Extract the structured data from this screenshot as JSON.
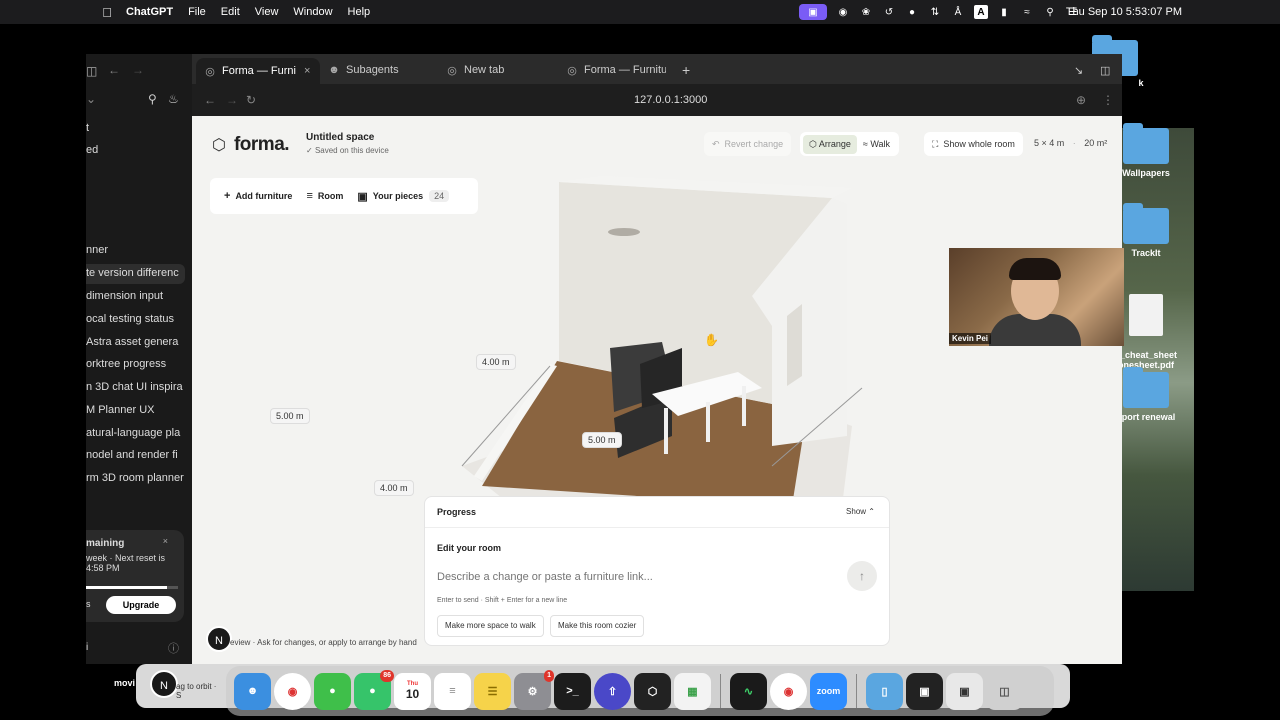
{
  "menubar": {
    "app_name": "ChatGPT",
    "menus": [
      "File",
      "Edit",
      "View",
      "Window",
      "Help"
    ],
    "status_icons": [
      "screen-record-icon",
      "zoom-icon",
      "openai-icon",
      "spiral-icon",
      "wechat-icon",
      "control-icon",
      "bluetooth-icon",
      "input-a-icon",
      "battery-icon",
      "wifi-icon",
      "search-icon",
      "control-center-icon"
    ],
    "input_source": "A",
    "clock": "Thu Sep 10  5:53:07 PM"
  },
  "desktop": {
    "items": [
      "k",
      "Wallpapers",
      "TrackIt",
      "3_cheat_sheet\nonesheet.pdf",
      "sport renewal"
    ]
  },
  "browser": {
    "tabs": [
      {
        "label": "Forma — Furni",
        "icon": "globe-icon",
        "active": true
      },
      {
        "label": "Subagents",
        "icon": "person-icon",
        "active": false
      },
      {
        "label": "New tab",
        "icon": "globe-icon",
        "active": false
      },
      {
        "label": "Forma — Furnitu",
        "icon": "globe-icon",
        "active": false
      }
    ],
    "url": "127.0.0.1:3000"
  },
  "sidebar": {
    "items": [
      "t",
      "ed",
      "nner",
      "te version differenc",
      " dimension input",
      "ocal testing status",
      " Astra asset genera",
      "orktree progress",
      "n 3D chat UI inspira",
      "M Planner UX",
      "atural-language pla",
      "nodel and render fi",
      "rm 3D room planner"
    ],
    "selected_index": 3,
    "usage": {
      "title": "maining",
      "line1": "week · Next reset is",
      "line2": "4:58 PM",
      "left_button": "s",
      "upgrade": "Upgrade",
      "used_fraction": 0.88
    },
    "footer_letter": "i"
  },
  "forma": {
    "brand": "forma.",
    "space_title": "Untitled space",
    "space_status": "Saved on this device",
    "revert": "Revert change",
    "arrange": "Arrange",
    "walk": "Walk",
    "show_room": "Show whole room",
    "room_dims": "5 × 4 m",
    "room_area": "20 m²",
    "toolbar": {
      "add": "Add furniture",
      "room": "Room",
      "pieces": "Your pieces",
      "pieces_count": "24"
    },
    "dimensions": {
      "left": "5.00 m",
      "right": "5.00 m",
      "bottom": "4.00 m",
      "table": "4.00 m"
    },
    "panel": {
      "header": "Progress",
      "toggle": "Show",
      "edit_title": "Edit your room",
      "placeholder": "Describe a change or paste a furniture link...",
      "hint": "Enter to send · Shift + Enter for a new line",
      "chips": [
        "Make more space to walk",
        "Make this room cozier"
      ]
    },
    "footer_note": "eview · Ask for changes, or apply to arrange by hand",
    "avatar_letter": "N"
  },
  "video": {
    "name": "Kevin Pei"
  },
  "dock": {
    "label": "movi",
    "drag_letter": "N",
    "drag_text": "ag to orbit · S",
    "messages_badge": "86",
    "settings_badge": "1",
    "calendar_day": "Thu",
    "calendar_date": "10",
    "zoom_label": "zoom"
  }
}
